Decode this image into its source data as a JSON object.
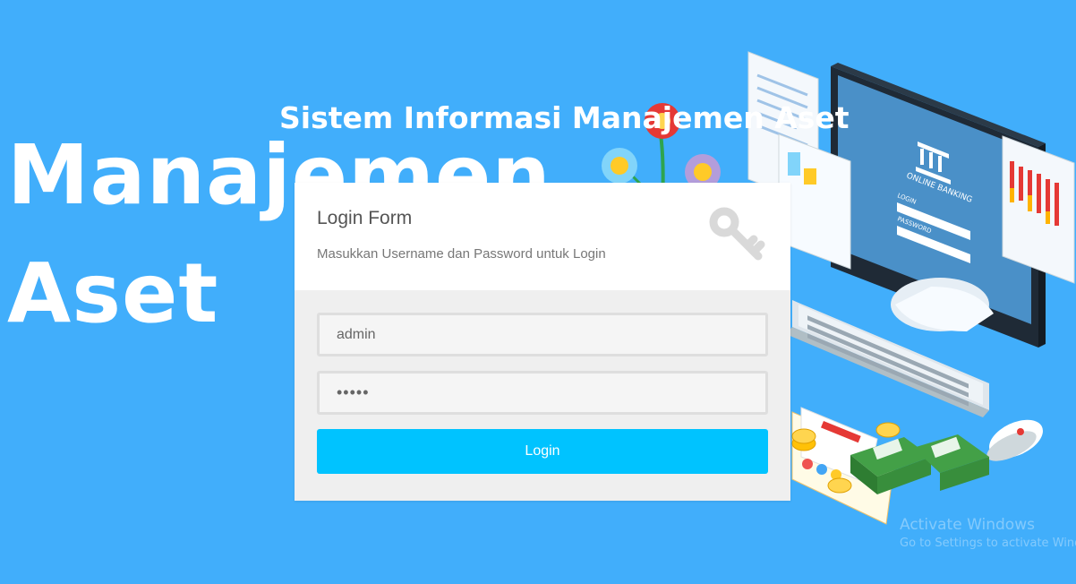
{
  "background_color": "#41aefb",
  "accent_color": "#00c3ff",
  "hero": {
    "line1": "Manajemen",
    "line2": "Aset"
  },
  "system_title": "Sistem Informasi Manajemen Aset",
  "login_form": {
    "title": "Login Form",
    "subtitle": "Masukkan Username dan Password untuk Login",
    "header_icon": "key-icon",
    "username_value": "admin",
    "password_value": "•••••",
    "button_label": "Login"
  },
  "illustration": {
    "screen_title": "ONLINE BANKING",
    "login_label": "LOGIN",
    "password_label": "PASSWORD"
  },
  "watermark": {
    "title": "Activate Windows",
    "subtitle": "Go to Settings to activate Windows."
  }
}
